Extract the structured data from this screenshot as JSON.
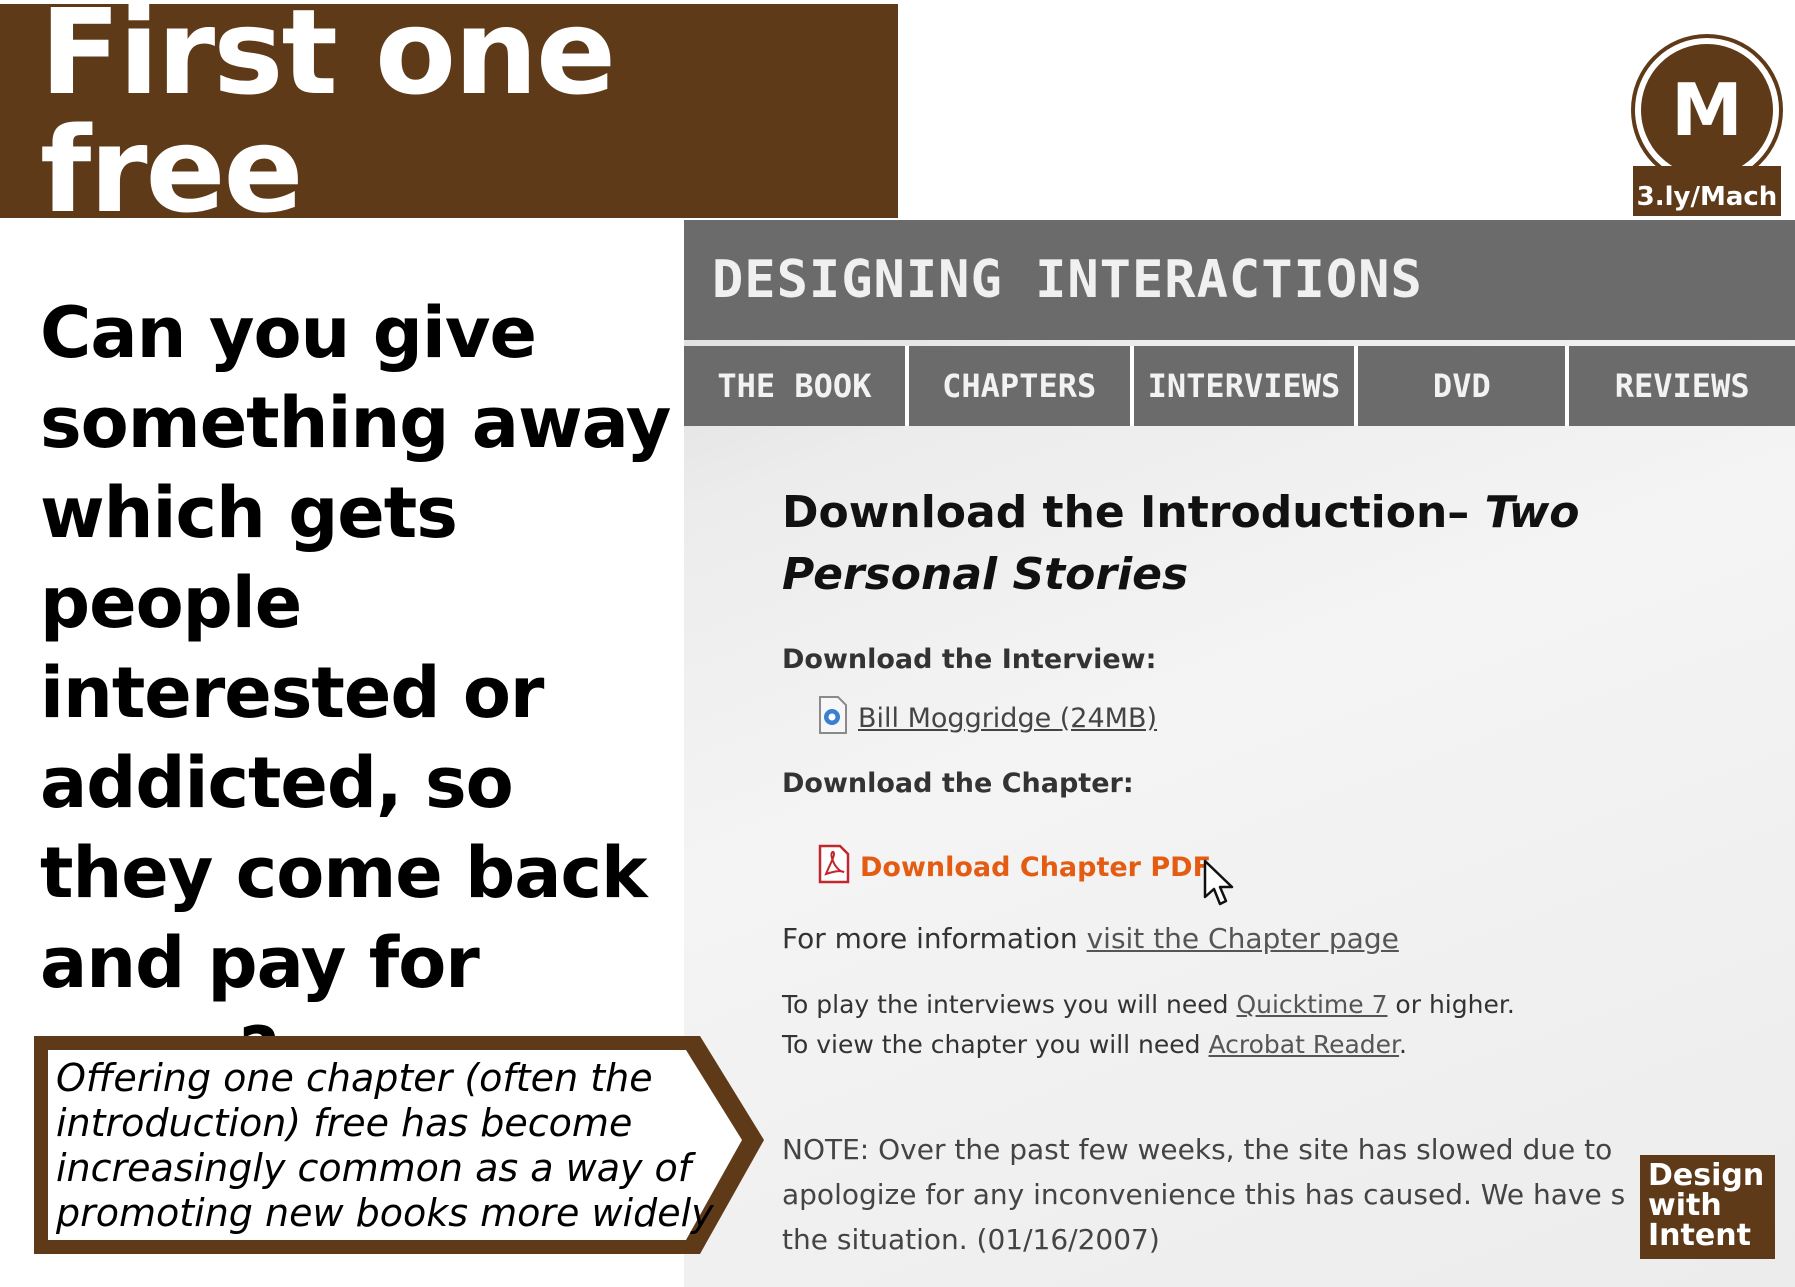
{
  "slide": {
    "title": "First one free",
    "question": "Can you give something away which gets people interested or addicted, so they come back and pay for more?",
    "callout": "Offering one chapter (often the introduction) free has become increasingly common as a way of promoting new books more widely"
  },
  "badge": {
    "letter": "M",
    "url": "3.ly/Mach"
  },
  "footer_badge": {
    "line1": "Design",
    "line2": "with",
    "line3": "Intent"
  },
  "website": {
    "site_name": "DESIGNING INTERACTIONS",
    "nav": [
      "THE BOOK",
      "CHAPTERS",
      "INTERVIEWS",
      "DVD",
      "REVIEWS"
    ],
    "heading_plain": "Download the Introduction– ",
    "heading_italic": "Two Personal Stories",
    "interview_label": "Download the Interview:",
    "interview_link": "Bill Moggridge (24MB)",
    "chapter_label": "Download the Chapter:",
    "chapter_link": "Download Chapter PDF",
    "more_info_prefix": "For more information ",
    "more_info_link": "visit the Chapter page",
    "quicktime_prefix": "To play the interviews you will need ",
    "quicktime_link": "Quicktime 7",
    "quicktime_suffix": " or higher.",
    "acrobat_prefix": "To view the chapter you will need ",
    "acrobat_link": "Acrobat Reader",
    "acrobat_suffix": ".",
    "note_line1": "NOTE: Over the past few weeks, the site has slowed due to",
    "note_line2": "apologize for any inconvenience this has caused. We have s",
    "note_line3": "the situation. (01/16/2007)"
  },
  "colors": {
    "brand_brown": "#5e3a18",
    "site_gray": "#6b6b6b",
    "pdf_orange": "#e45b12"
  },
  "icons": {
    "interview": "quicktime-file-icon",
    "chapter": "pdf-file-icon",
    "cursor": "mouse-pointer-icon"
  }
}
